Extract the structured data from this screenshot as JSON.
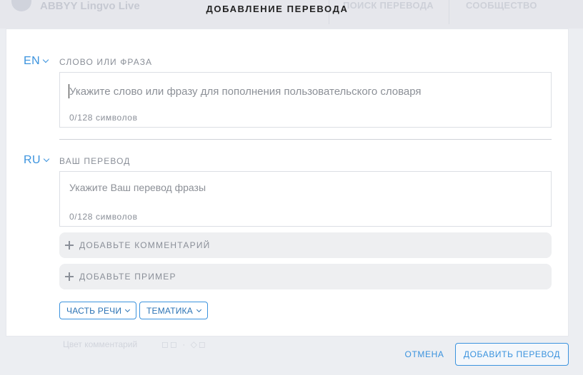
{
  "background": {
    "brand": "ABBYY Lingvo Live",
    "nav": [
      "ПОИСК ПЕРЕВОДА",
      "СООБЩЕСТВО"
    ],
    "footer_text": "Цвет комментарий"
  },
  "modal": {
    "title": "ДОБАВЛЕНИЕ ПЕРЕВОДА",
    "source": {
      "lang": "EN",
      "label": "СЛОВО ИЛИ ФРАЗА",
      "placeholder": "Укажите слово или фразу для пополнения пользовательского словаря",
      "counter": "0/128 символов"
    },
    "target": {
      "lang": "RU",
      "label": "ВАШ ПЕРЕВОД",
      "placeholder": "Укажите Ваш перевод фразы",
      "counter": "0/128 символов"
    },
    "add_comment": "ДОБАВЬТЕ КОММЕНТАРИЙ",
    "add_example": "ДОБАВЬТЕ ПРИМЕР",
    "part_of_speech": "ЧАСТЬ РЕЧИ",
    "topic": "ТЕМАТИКА",
    "cancel": "ОТМЕНА",
    "submit": "ДОБАВИТЬ ПЕРЕВОД"
  },
  "colors": {
    "accent": "#3b93de",
    "muted_text": "#8a8f98",
    "card": "#ffffff"
  }
}
